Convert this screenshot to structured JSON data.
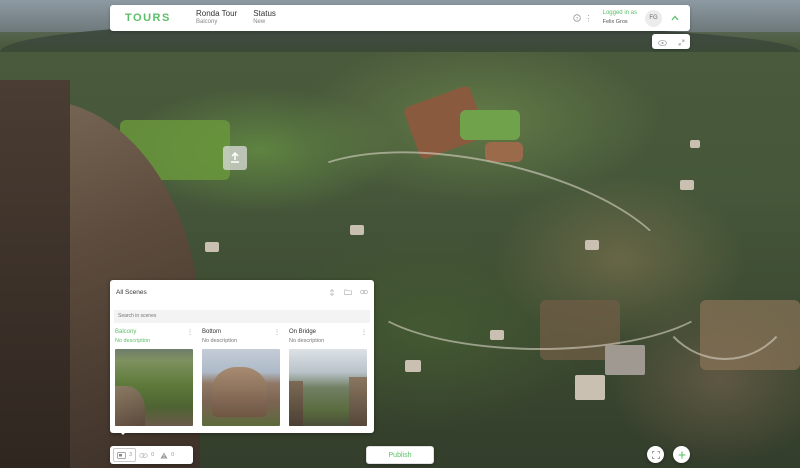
{
  "app": {
    "logo": "TOURS"
  },
  "header": {
    "tour_label": "Ronda Tour",
    "tour_value": "Balcony",
    "status_label": "Status",
    "status_value": "New",
    "login_label": "Logged in as",
    "login_user": "Felix Gros",
    "avatar_initials": "FG"
  },
  "icons": {
    "help": "help-circle-icon",
    "more": "more-vertical-icon",
    "collapse": "chevron-up-icon",
    "eye": "eye-icon",
    "expand": "expand-icon",
    "hotspot": "upload-hotspot-icon"
  },
  "scenes_panel": {
    "title": "All Scenes",
    "search_placeholder": "Search in scenes",
    "cards": [
      {
        "name": "Balcony",
        "description": "No description",
        "active": true
      },
      {
        "name": "Bottom",
        "description": "No description",
        "active": false
      },
      {
        "name": "On Bridge",
        "description": "No description",
        "active": false
      }
    ]
  },
  "bottom_toolbar": {
    "scenes_count": "3",
    "links_count": "0",
    "warnings_count": "0"
  },
  "actions": {
    "publish": "Publish"
  },
  "colors": {
    "accent": "#5cbf68",
    "panel": "#ffffff",
    "muted": "#999999"
  }
}
